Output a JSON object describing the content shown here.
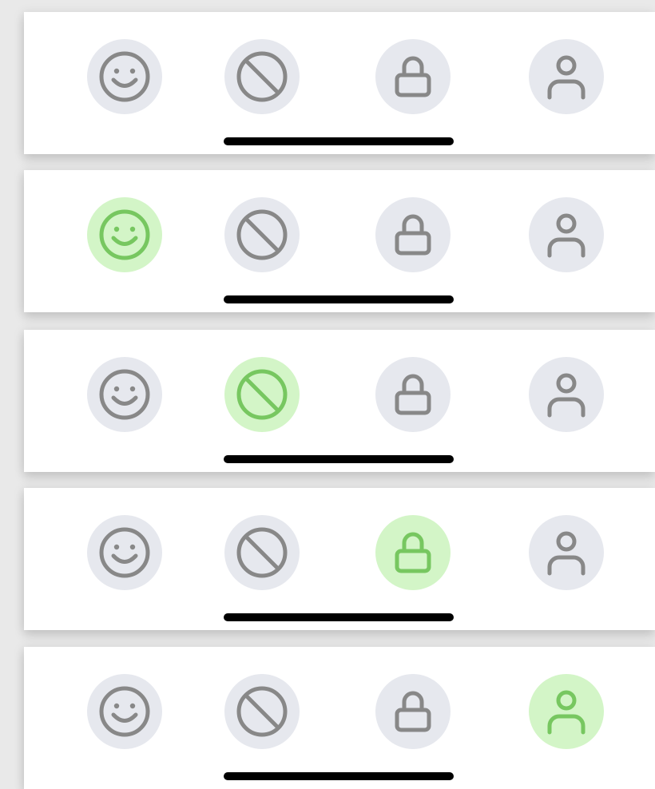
{
  "icon_color": "#888888",
  "active_icon_color": "#77c760",
  "button_bg": "#e6e8ee",
  "active_button_bg": "#d3f5c7",
  "panels": [
    {
      "active_index": null,
      "buttons": [
        {
          "icon": "smile-icon"
        },
        {
          "icon": "block-icon"
        },
        {
          "icon": "lock-icon"
        },
        {
          "icon": "user-icon"
        }
      ]
    },
    {
      "active_index": 0,
      "buttons": [
        {
          "icon": "smile-icon"
        },
        {
          "icon": "block-icon"
        },
        {
          "icon": "lock-icon"
        },
        {
          "icon": "user-icon"
        }
      ]
    },
    {
      "active_index": 1,
      "buttons": [
        {
          "icon": "smile-icon"
        },
        {
          "icon": "block-icon"
        },
        {
          "icon": "lock-icon"
        },
        {
          "icon": "user-icon"
        }
      ]
    },
    {
      "active_index": 2,
      "buttons": [
        {
          "icon": "smile-icon"
        },
        {
          "icon": "block-icon"
        },
        {
          "icon": "lock-icon"
        },
        {
          "icon": "user-icon"
        }
      ]
    },
    {
      "active_index": 3,
      "buttons": [
        {
          "icon": "smile-icon"
        },
        {
          "icon": "block-icon"
        },
        {
          "icon": "lock-icon"
        },
        {
          "icon": "user-icon"
        }
      ]
    }
  ]
}
